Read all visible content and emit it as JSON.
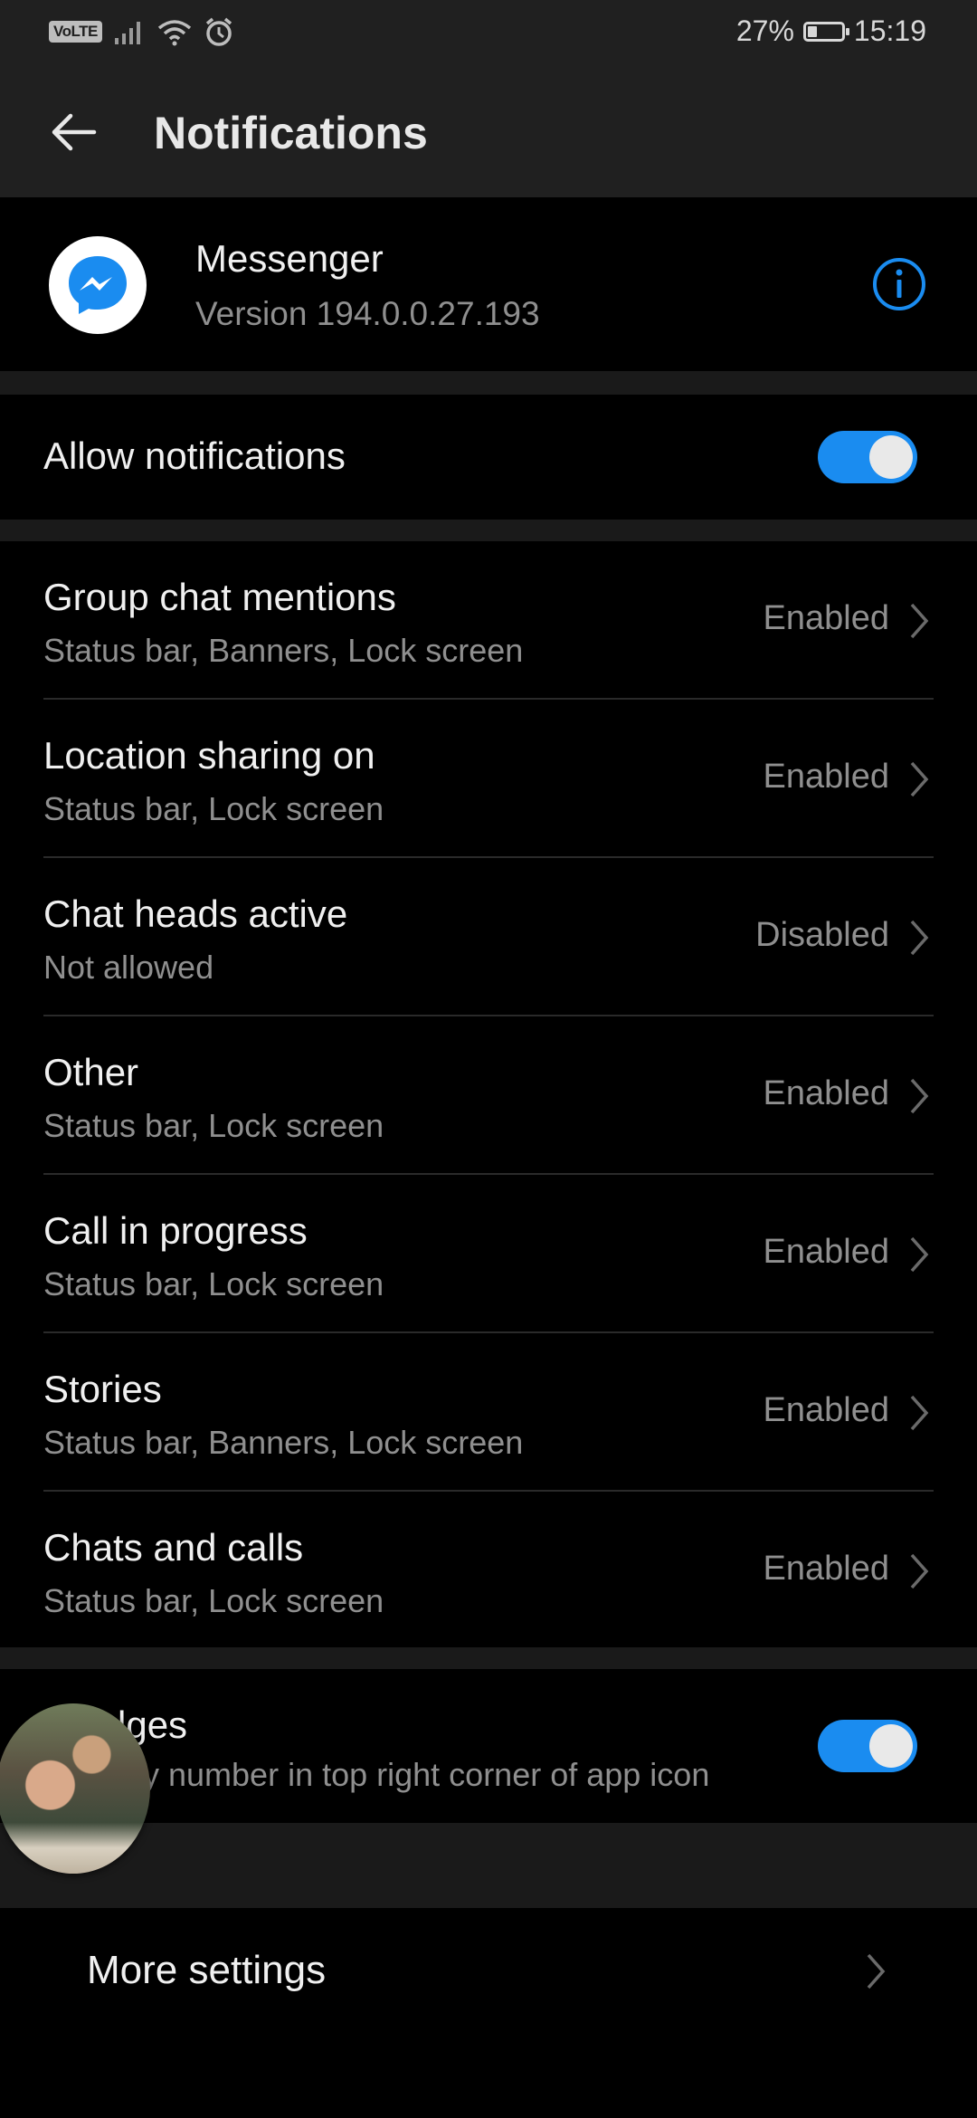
{
  "status_bar": {
    "volte": "VoLTE",
    "battery": "27%",
    "battery_level": 0.27,
    "time": "15:19",
    "icons": [
      "signal-icon",
      "wifi-icon",
      "alarm-icon",
      "battery-icon"
    ]
  },
  "app_bar": {
    "title": "Notifications",
    "back_icon": "back-arrow-icon"
  },
  "app": {
    "name": "Messenger",
    "version": "Version 194.0.0.27.193",
    "icon": "messenger-icon",
    "info_icon": "info-icon",
    "accent": "#1a8cf0"
  },
  "allow": {
    "label": "Allow notifications",
    "enabled": true
  },
  "categories": [
    {
      "title": "Group chat mentions",
      "subtitle": "Status bar, Banners, Lock screen",
      "status": "Enabled"
    },
    {
      "title": "Location sharing on",
      "subtitle": "Status bar, Lock screen",
      "status": "Enabled"
    },
    {
      "title": "Chat heads active",
      "subtitle": "Not allowed",
      "status": "Disabled"
    },
    {
      "title": "Other",
      "subtitle": "Status bar, Lock screen",
      "status": "Enabled"
    },
    {
      "title": "Call in progress",
      "subtitle": "Status bar, Lock screen",
      "status": "Enabled"
    },
    {
      "title": "Stories",
      "subtitle": "Status bar, Banners, Lock screen",
      "status": "Enabled"
    },
    {
      "title": "Chats and calls",
      "subtitle": "Status bar, Lock screen",
      "status": "Enabled"
    }
  ],
  "badges": {
    "title_visible": "lges",
    "subtitle_visible": "y number in top right corner of app icon",
    "enabled": true
  },
  "more_settings": {
    "label": "More settings"
  }
}
